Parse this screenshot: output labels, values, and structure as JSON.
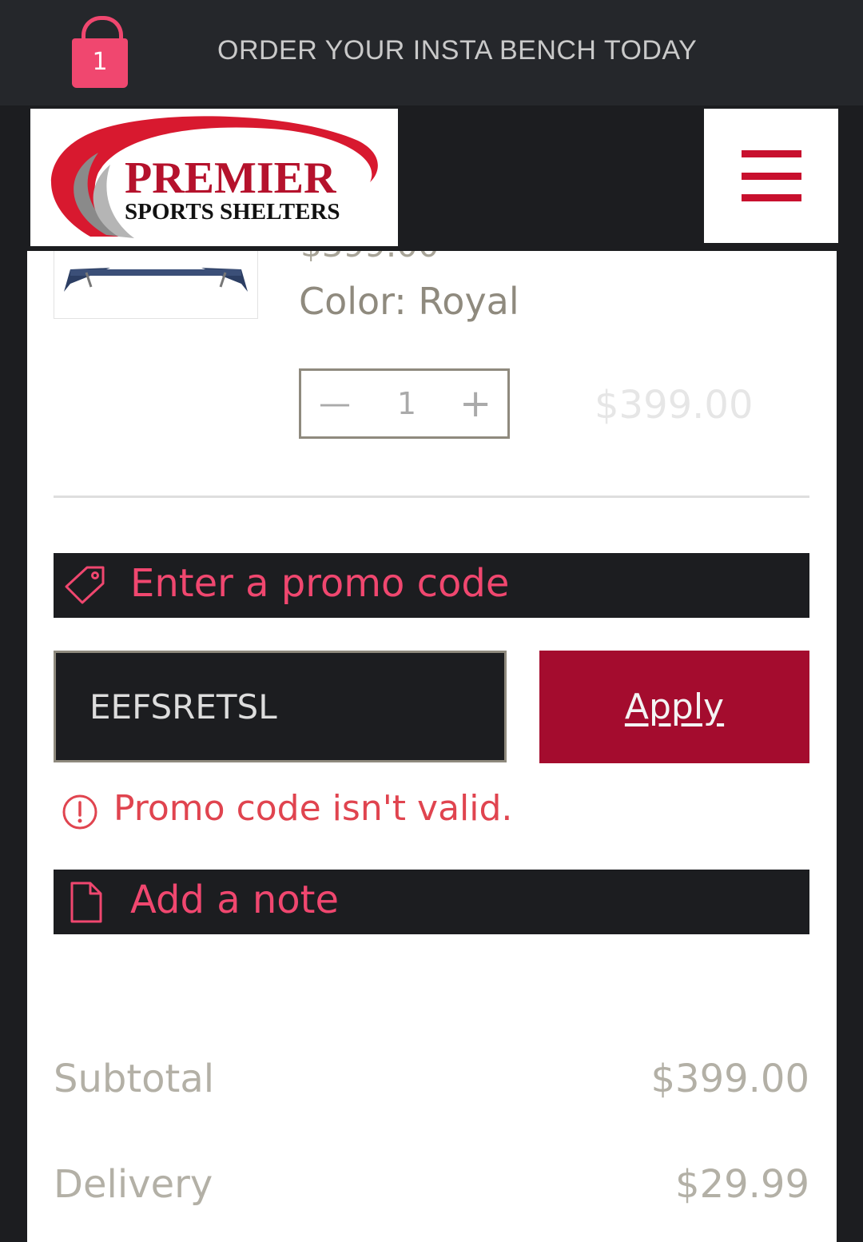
{
  "header": {
    "cart_count": "1",
    "announcement": "ORDER YOUR INSTA BENCH TODAY",
    "logo": {
      "title": "PREMIER",
      "subtitle": "SPORTS SHELTERS"
    }
  },
  "cart_item": {
    "old_price": "$399.00",
    "color": "Color: Royal",
    "quantity": "1",
    "price": "$399.00"
  },
  "promo": {
    "toggle_label": "Enter a promo code",
    "input_value": "EEFSRETSL",
    "apply_label": "Apply",
    "error_message": "Promo code isn't valid."
  },
  "note": {
    "toggle_label": "Add a note"
  },
  "summary": {
    "subtotal_label": "Subtotal",
    "subtotal_value": "$399.00",
    "delivery_label": "Delivery",
    "delivery_value": "$29.99"
  },
  "icons": {
    "cart": "shopping-bag-icon",
    "menu": "hamburger-menu-icon",
    "promo": "tag-icon",
    "error": "alert-circle-icon",
    "note": "document-icon"
  },
  "colors": {
    "accent_pink": "#f0476f",
    "brand_red": "#c8102e",
    "apply_button": "#a40c2e",
    "error_red": "#e0444f",
    "dark_bg": "#1c1d20"
  }
}
